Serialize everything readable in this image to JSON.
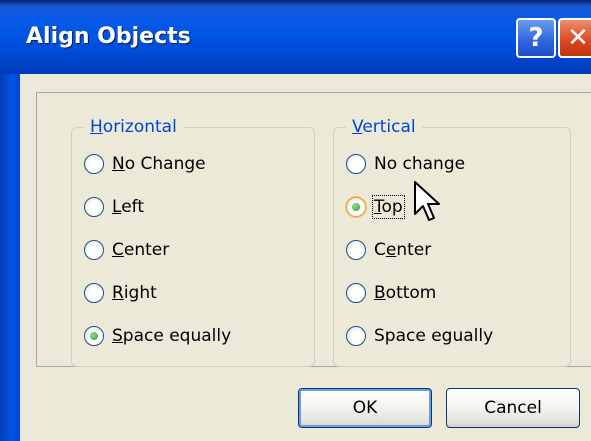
{
  "window": {
    "title": "Align Objects",
    "help_label": "?",
    "close_label": "✕"
  },
  "horizontal": {
    "legend_prefix": "H",
    "legend_rest": "orizontal",
    "options": [
      {
        "key": "N",
        "rest": "o Change",
        "checked": false
      },
      {
        "key": "L",
        "rest": "eft",
        "checked": false
      },
      {
        "key": "C",
        "rest": "enter",
        "checked": false
      },
      {
        "key": "R",
        "rest": "ight",
        "checked": false
      },
      {
        "key": "S",
        "rest": "pace equally",
        "checked": true
      }
    ]
  },
  "vertical": {
    "legend_prefix": "V",
    "legend_rest": "ertical",
    "options": [
      {
        "label": "No change",
        "checked": false
      },
      {
        "pre": "",
        "key": "T",
        "rest": "op",
        "checked": true
      },
      {
        "pre": "C",
        "key": "e",
        "rest": "nter",
        "checked": false
      },
      {
        "pre": "",
        "key": "B",
        "rest": "ottom",
        "checked": false
      },
      {
        "label": "Space egually",
        "checked": false
      }
    ]
  },
  "buttons": {
    "ok": "OK",
    "cancel": "Cancel"
  },
  "colors": {
    "titlebar": "#0055e5",
    "face": "#ece9d8",
    "legend": "#0046d5",
    "radio_checked": "#21a121"
  },
  "icons": {
    "help": "help-icon",
    "close": "close-icon",
    "cursor": "arrow-cursor-icon"
  }
}
